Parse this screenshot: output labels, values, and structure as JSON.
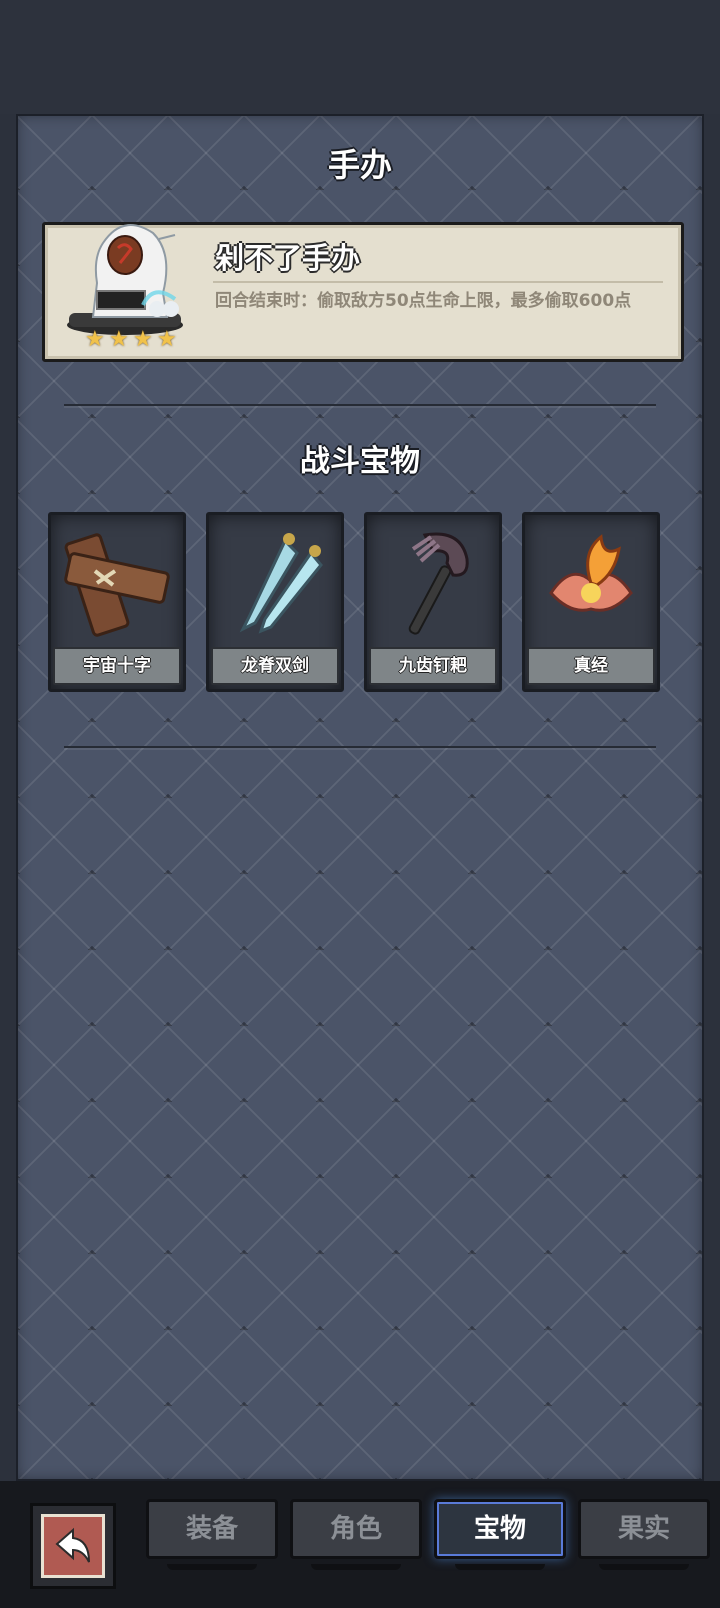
{
  "page": {
    "title": "手办"
  },
  "figure": {
    "name": "剁不了手办",
    "description": "回合结束时：偷取敌方50点生命上限，最多偷取600点",
    "stars": 4
  },
  "section": {
    "title": "战斗宝物"
  },
  "treasures": [
    {
      "name": "宇宙十字",
      "icon": "wooden-cross-icon"
    },
    {
      "name": "龙脊双剑",
      "icon": "twin-swords-icon"
    },
    {
      "name": "九齿钉耙",
      "icon": "rake-icon"
    },
    {
      "name": "真经",
      "icon": "fire-lotus-icon"
    }
  ],
  "tabs": [
    {
      "label": "装备",
      "active": false
    },
    {
      "label": "角色",
      "active": false
    },
    {
      "label": "宝物",
      "active": true
    },
    {
      "label": "果实",
      "active": false
    }
  ],
  "colors": {
    "accent": "#5a7bd8",
    "star": "#f1c24a",
    "panel": "#4b5468"
  }
}
